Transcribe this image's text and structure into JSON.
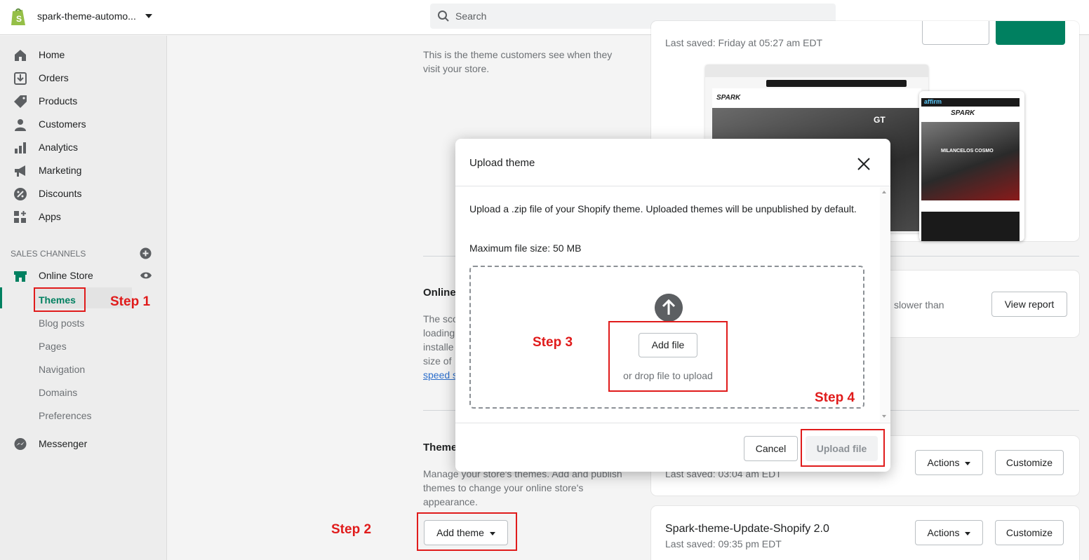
{
  "topbar": {
    "store_name": "spark-theme-automo...",
    "search_placeholder": "Search"
  },
  "sidebar": {
    "items": [
      {
        "label": "Home",
        "icon": "home-icon"
      },
      {
        "label": "Orders",
        "icon": "orders-icon"
      },
      {
        "label": "Products",
        "icon": "tag-icon"
      },
      {
        "label": "Customers",
        "icon": "person-icon"
      },
      {
        "label": "Analytics",
        "icon": "bar-chart-icon"
      },
      {
        "label": "Marketing",
        "icon": "megaphone-icon"
      },
      {
        "label": "Discounts",
        "icon": "discount-icon"
      },
      {
        "label": "Apps",
        "icon": "apps-icon"
      }
    ],
    "sales_channels_heading": "SALES CHANNELS",
    "online_store": "Online Store",
    "sub_items": [
      "Themes",
      "Blog posts",
      "Pages",
      "Navigation",
      "Domains",
      "Preferences"
    ],
    "messenger": "Messenger",
    "active_color": "#008060"
  },
  "main": {
    "current_theme_desc_1": "This is the theme customers see when they",
    "current_theme_desc_2": "visit your store.",
    "last_saved_top": "Last saved: Friday at 05:27 am EDT",
    "speed_heading": "Online",
    "speed_desc": [
      "The sco",
      "loading",
      "installe",
      "size of"
    ],
    "speed_link": "speed s",
    "speed_slower": "slower than",
    "view_report": "View report",
    "themes_heading": "Theme",
    "themes_desc_1": "Manage your store's themes. Add and publish",
    "themes_desc_2": "themes to change your online store's",
    "themes_desc_3": "appearance.",
    "add_theme": "Add theme",
    "library_saved_1": "Last saved: 03:04 am EDT",
    "library_theme_2_name": "Spark-theme-Update-Shopify 2.0",
    "library_saved_2": "Last saved: 09:35 pm EDT",
    "actions": "Actions",
    "customize": "Customize"
  },
  "preview": {
    "desktop_brand": "SPARK",
    "mobile_brand": "SPARK",
    "affirm": "affirm",
    "mobile_headline": "MILANCELOS COSMO",
    "desktop_tag": "GT"
  },
  "modal": {
    "title": "Upload theme",
    "description": "Upload a .zip file of your Shopify theme. Uploaded themes will be unpublished by default.",
    "max_size": "Maximum file size: 50 MB",
    "add_file": "Add file",
    "drop_text": "or drop file to upload",
    "cancel": "Cancel",
    "upload_file": "Upload file"
  },
  "annotations": {
    "step1": "Step 1",
    "step2": "Step 2",
    "step3": "Step 3",
    "step4": "Step 4",
    "color": "#e01b1b"
  }
}
